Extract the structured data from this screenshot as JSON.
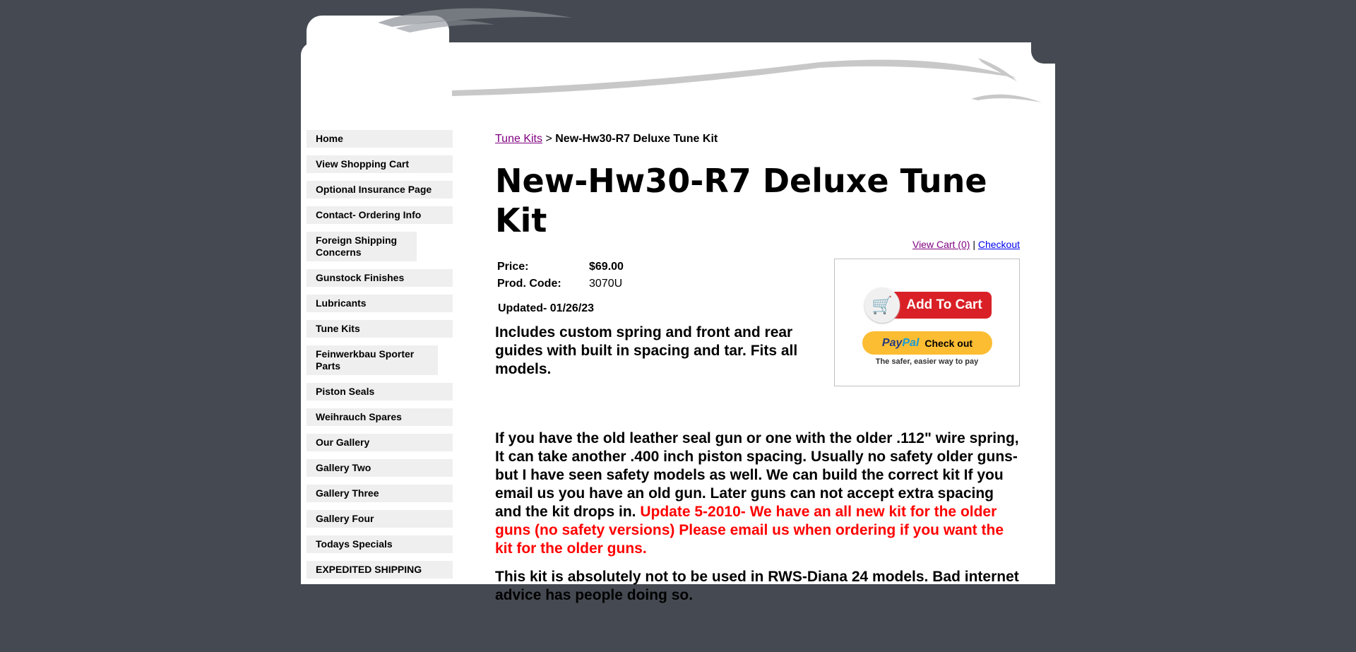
{
  "nav": [
    "Home",
    "View Shopping Cart",
    "Optional Insurance Page",
    "Contact- Ordering Info",
    "Foreign Shipping Concerns",
    "Gunstock Finishes",
    "Lubricants",
    "Tune Kits",
    "Feinwerkbau Sporter Parts",
    "Piston Seals",
    "Weihrauch Spares",
    "Our Gallery",
    "Gallery Two",
    "Gallery Three",
    "Gallery Four",
    "Todays Specials",
    "EXPEDITED SHIPPING"
  ],
  "breadcrumb": {
    "parent": "Tune Kits",
    "separator": ">",
    "current": "New-Hw30-R7 Deluxe Tune Kit"
  },
  "title": "New-Hw30-R7 Deluxe Tune Kit",
  "cart_links": {
    "view_cart": "View Cart (0)",
    "separator": "|",
    "checkout": "Checkout"
  },
  "product": {
    "price_label": "Price:",
    "price": "$69.00",
    "code_label": "Prod. Code:",
    "code": "3070U",
    "updated": "Updated- 01/26/23"
  },
  "intro": "Includes custom spring and front and rear guides with built in spacing and tar. Fits all models.",
  "buy": {
    "add_to_cart": "Add To Cart",
    "paypal_pay": "Pay",
    "paypal_pal": "Pal",
    "paypal_checkout": "Check out",
    "paypal_tagline": "The safer, easier way to pay"
  },
  "description": {
    "main": "If you have the old leather seal gun or one with the older .112\" wire spring, It can take another .400 inch piston spacing. Usually no safety older guns- but I have seen safety models as well. We can build the correct kit If you email us you have an old gun. Later guns can not accept extra spacing and the kit drops in. ",
    "update": "Update 5-2010- We have an all new kit for the older guns (no safety versions) Please email us when ordering if you want the kit for the older guns.",
    "warning": "This kit is absolutely not to be used in RWS-Diana 24 models. Bad internet advice has people doing so."
  },
  "colors": {
    "background": "#454a52",
    "update_text": "#ff0000",
    "nav_bg": "#efefef"
  }
}
